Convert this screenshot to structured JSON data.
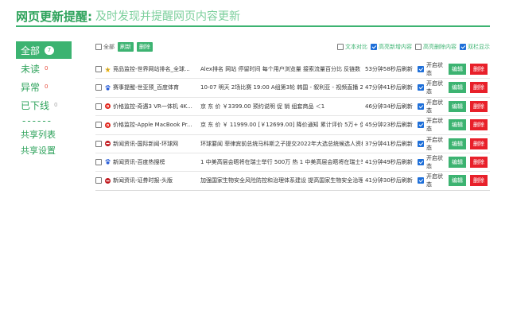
{
  "header": {
    "title": "网页更新提醒:",
    "subtitle": "及时发现并提醒网页内容更新"
  },
  "sidebar": {
    "items": [
      {
        "label": "全部",
        "badge": "7",
        "active": true
      },
      {
        "label": "未读",
        "badge": "0",
        "active": false
      },
      {
        "label": "异常",
        "badge": "0",
        "active": false
      },
      {
        "label": "已下线",
        "badge": "0",
        "active": false
      }
    ],
    "separator": "------",
    "links": [
      "共享列表",
      "共享设置"
    ]
  },
  "toolbar": {
    "select_all": "全部",
    "refresh": "刷新",
    "delete": "删除",
    "options": [
      {
        "label": "文本对比",
        "checked": false
      },
      {
        "label": "高亮新增内容",
        "checked": true
      },
      {
        "label": "高亮删除内容",
        "checked": false
      },
      {
        "label": "双栏显示",
        "checked": true
      }
    ]
  },
  "rows": [
    {
      "icon": "star-rainbow-icon",
      "name": "竞品监控-世界网站排名_全球...",
      "content": "Alex排名 网站 停留时间 每个用户浏览量 接索流量百分比 反链数 ...",
      "time": "53分钟58秒后刷新",
      "status": "开启状态",
      "edit": "编辑",
      "delete": "删除"
    },
    {
      "icon": "paw-icon",
      "name": "赛事提醒-世亚预_百度体育",
      "content": "10-07 明天 2场比赛 19:00 A组第3轮 韩国 - 叙利亚 - 视频直播 22:30 A...",
      "time": "47分钟41秒后刷新",
      "status": "开启状态",
      "edit": "编辑",
      "delete": "删除"
    },
    {
      "icon": "jd-icon",
      "name": "价格监控-奇遇3 VR一体机 4K...",
      "content": "京 东 价 ￥3399.00 预约说明 促 销 组套商品 ＜1",
      "time": "46分钟34秒后刷新",
      "status": "开启状态",
      "edit": "编辑",
      "delete": "删除"
    },
    {
      "icon": "jd-icon",
      "name": "价格监控-Apple MacBook Pr...",
      "content": "京 东 价 ￥ 11999.00 [￥12699.00] 降价通知 累计评价 5万+ 促 ...",
      "time": "45分钟23秒后刷新",
      "status": "开启状态",
      "edit": "编辑",
      "delete": "删除"
    },
    {
      "icon": "news-icon",
      "name": "新闻资讯-国际新闻-环球网",
      "content": "环球要闻 菲律宾前总统马科斯之子提交2022年大选总统候选人资格证书 ...",
      "time": "37分钟41秒后刷新",
      "status": "开启状态",
      "edit": "编辑",
      "delete": "删除"
    },
    {
      "icon": "paw-icon",
      "name": "新闻资讯-百度热搜榜",
      "content": "1 中美高层会晤将在瑞士举行 500万 热 1 中美高层会晤将在瑞士举行 500万 ...",
      "time": "41分钟49秒后刷新",
      "status": "开启状态",
      "edit": "编辑",
      "delete": "删除"
    },
    {
      "icon": "news-icon",
      "name": "新闻资讯-证券时报-头版",
      "content": "加强国家生物安全风险防控和治理体系建设 提高国家生物安全治理能力 深...",
      "time": "41分钟30秒后刷新",
      "status": "开启状态",
      "edit": "编辑",
      "delete": "删除"
    }
  ],
  "colors": {
    "accent": "#3cb371",
    "danger": "#e8202a",
    "checkbox": "#1e6fd9"
  }
}
